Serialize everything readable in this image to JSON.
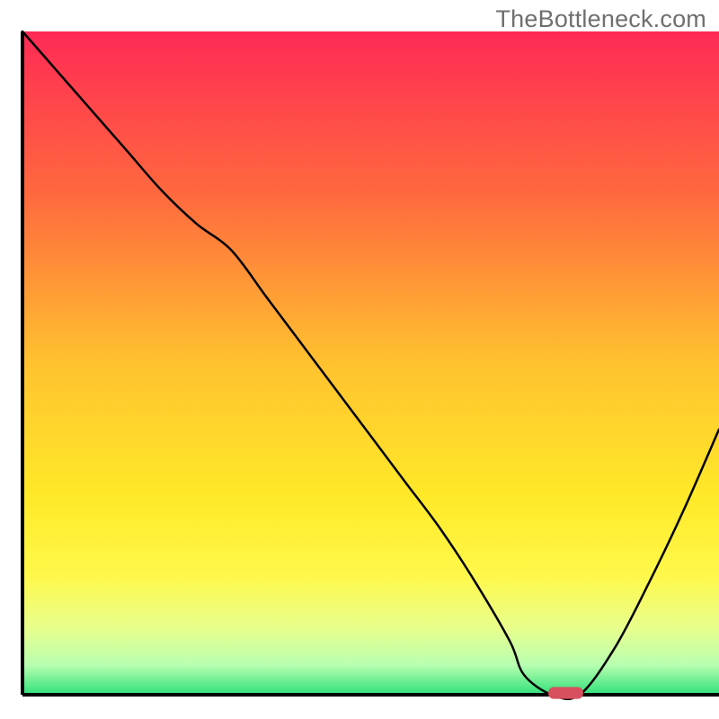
{
  "watermark": "TheBottleneck.com",
  "chart_data": {
    "type": "line",
    "title": "",
    "xlabel": "",
    "ylabel": "",
    "xlim": [
      0,
      100
    ],
    "ylim": [
      0,
      100
    ],
    "axes": {
      "left": true,
      "bottom": true,
      "right": false,
      "top": false
    },
    "background_gradient": {
      "stops": [
        {
          "offset": 0.0,
          "color": "#ff2a55"
        },
        {
          "offset": 0.25,
          "color": "#ff6a3e"
        },
        {
          "offset": 0.5,
          "color": "#ffc22f"
        },
        {
          "offset": 0.7,
          "color": "#ffe928"
        },
        {
          "offset": 0.82,
          "color": "#fff84a"
        },
        {
          "offset": 0.9,
          "color": "#e8ff8d"
        },
        {
          "offset": 0.955,
          "color": "#b8ffb0"
        },
        {
          "offset": 1.0,
          "color": "#2fe07a"
        }
      ]
    },
    "series": [
      {
        "name": "bottleneck-curve",
        "color": "#000000",
        "width": 2.5,
        "x": [
          0,
          5,
          10,
          15,
          20,
          25,
          30,
          35,
          40,
          45,
          50,
          55,
          60,
          65,
          70,
          72,
          76,
          80,
          85,
          90,
          95,
          100
        ],
        "y": [
          100,
          94,
          88,
          82,
          76,
          71,
          67,
          60,
          53,
          46,
          39,
          32,
          25,
          17,
          8,
          3,
          0,
          0,
          7,
          17,
          28,
          40
        ]
      }
    ],
    "marker": {
      "name": "optimal-point",
      "x": 78,
      "y": 0,
      "width_pct": 5,
      "height_pct": 1.8,
      "color": "#d8505e"
    }
  }
}
